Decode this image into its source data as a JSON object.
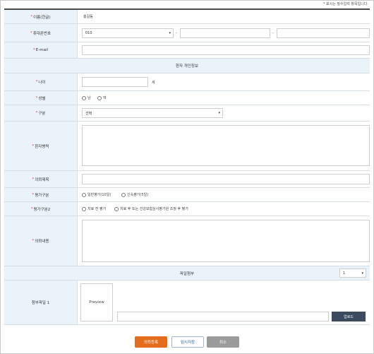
{
  "header_note": "* 표시는 필수입력 항목입니다.",
  "fields": {
    "name": {
      "label": "이름(한글)",
      "value": "홍길동"
    },
    "phone": {
      "label": "휴대폰번호",
      "prefix": "010",
      "sep1": "-",
      "sep2": "-"
    },
    "email": {
      "label": "E-mail"
    }
  },
  "section_patient": "환자 개인정보",
  "patient": {
    "age": {
      "label": "나이",
      "unit": "세"
    },
    "sex": {
      "label": "성별",
      "options": [
        "남",
        "여"
      ]
    },
    "category": {
      "label": "구분",
      "selected": "선택"
    },
    "history": {
      "label": "환자병력"
    },
    "title": {
      "label": "의뢰제목"
    },
    "eval_type": {
      "label": "평가구분",
      "options": [
        "일반평가(10일)",
        "신속평가(5일)"
      ]
    },
    "eval_type2": {
      "label": "평가구분2",
      "options": [
        "치료 전 평가",
        "치료 후 또는 건강보험심사평가원 조정 후 평가"
      ]
    },
    "content": {
      "label": "의뢰내용"
    }
  },
  "attachments": {
    "section_label": "파일첨부",
    "count_selected": "1",
    "file_label": "첨부파일 1",
    "preview_label": "Preview",
    "upload_label": "업로드"
  },
  "buttons": {
    "submit": "의뢰등록",
    "temp_save": "임시저장",
    "cancel": "취소"
  },
  "colors": {
    "label_bg": "#eaf3fa",
    "required": "#e23a3a",
    "submit": "#e46c1a",
    "cancel": "#9a9a9a",
    "upload": "#3b4a5e"
  }
}
